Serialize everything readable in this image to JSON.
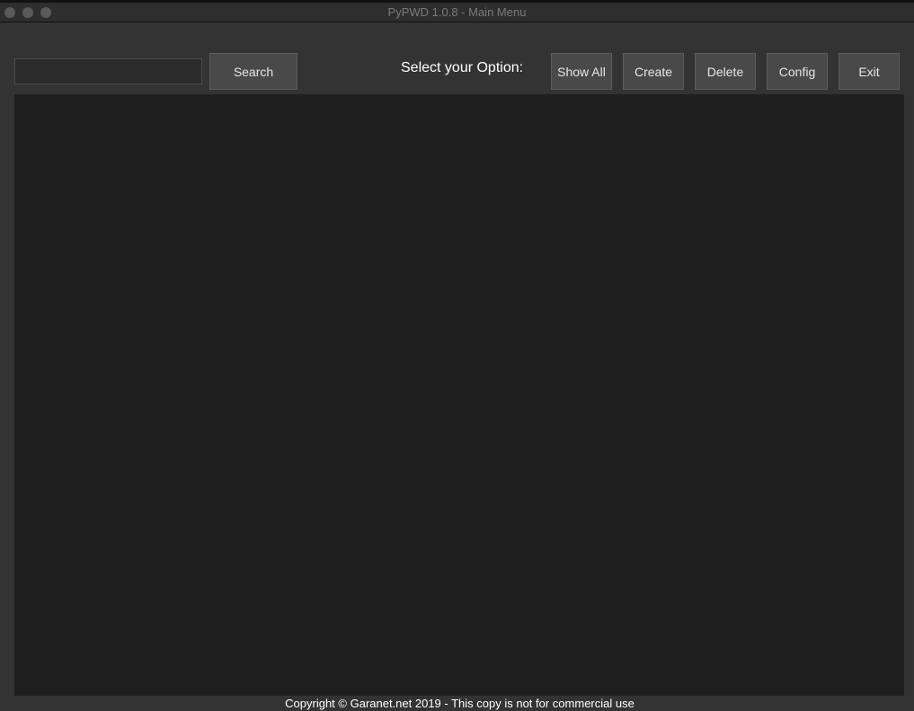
{
  "window": {
    "title": "PyPWD 1.0.8 - Main Menu"
  },
  "search": {
    "value": "",
    "button": "Search"
  },
  "options": {
    "label": "Select your Option:",
    "buttons": [
      "Show All",
      "Create",
      "Delete",
      "Config",
      "Exit"
    ]
  },
  "footer": {
    "text": "Copyright © Garanet.net 2019 - This copy is not for commercial use"
  }
}
